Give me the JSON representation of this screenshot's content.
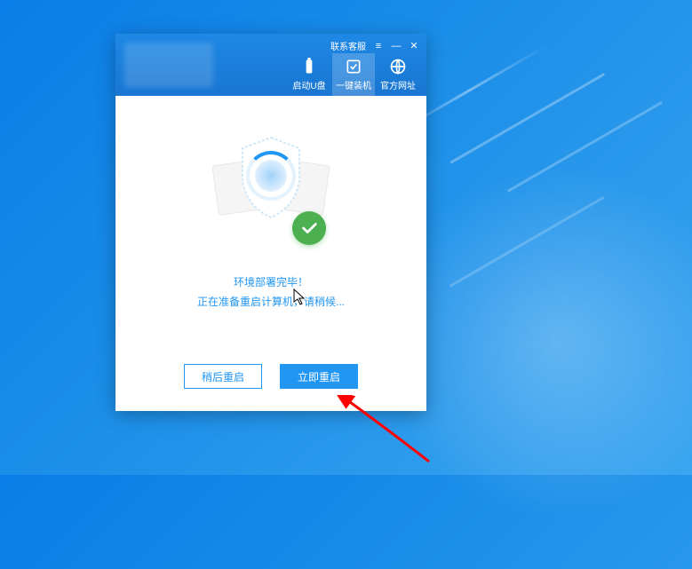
{
  "titlebar": {
    "contact_label": "联系客服"
  },
  "nav": {
    "tabs": [
      {
        "label": "启动U盘"
      },
      {
        "label": "一键装机"
      },
      {
        "label": "官方网址"
      }
    ]
  },
  "status": {
    "title": "环境部署完毕！",
    "subtitle": "正在准备重启计算机，请稍候..."
  },
  "buttons": {
    "later": "稍后重启",
    "now": "立即重启"
  }
}
